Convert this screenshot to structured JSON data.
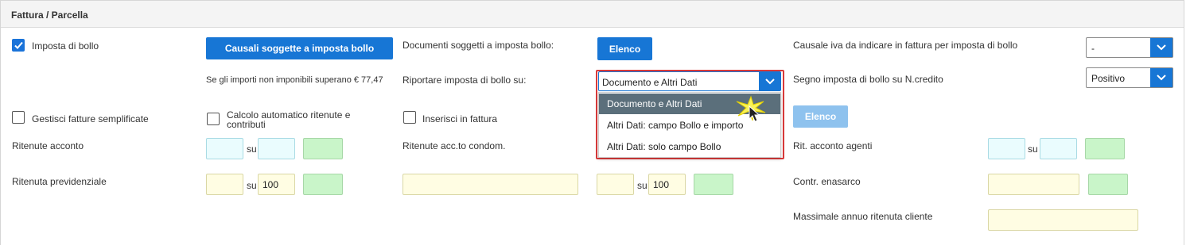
{
  "panel": {
    "title": "Fattura / Parcella"
  },
  "row1": {
    "imposta_bollo_label": "Imposta di bollo",
    "imposta_bollo_checked": true,
    "causali_button": "Causali soggette a imposta bollo",
    "documenti_label": "Documenti  soggetti a imposta bollo:",
    "elenco_button": "Elenco",
    "causale_iva_label": "Causale iva da indicare in fattura per imposta di bollo",
    "causale_iva_value": "-"
  },
  "row2": {
    "importi_note": "Se gli importi non imponibili superano € 77,47",
    "riportare_label": "Riportare imposta di bollo su:",
    "riportare_value": "Documento e Altri Dati",
    "segno_label": "Segno imposta di bollo su N.credito",
    "segno_value": "Positivo"
  },
  "dropdown": {
    "options": [
      "Documento e Altri Dati",
      "Altri Dati: campo Bollo e importo",
      "Altri Dati: solo campo Bollo"
    ],
    "selected_index": 0
  },
  "row3": {
    "gestisci_label": "Gestisci fatture semplificate",
    "calcolo_label_line1": "Calcolo automatico ritenute e",
    "calcolo_label_line2": "contributi",
    "inserisci_label": "Inserisci in fattura",
    "elenco_disabled_button": "Elenco"
  },
  "row4": {
    "ritenute_acconto_label": "Ritenute acconto",
    "su_label": "su",
    "ritenute_condom_label": "Ritenute acc.to condom.",
    "rit_agenti_label": "Rit. acconto agenti",
    "su_label_2": "su"
  },
  "row5": {
    "ritenuta_prev_label": "Ritenuta previdenziale",
    "su_label": "su",
    "su_value": "100",
    "su_label_2": "su",
    "su_value_2": "100",
    "enasarco_label": "Contr. enasarco"
  },
  "row6": {
    "massimale_label": "Massimale annuo ritenuta cliente"
  },
  "colors": {
    "accent": "#1776d5",
    "highlight": "#d93a3a",
    "dropdown_active": "#5b6f7b"
  }
}
